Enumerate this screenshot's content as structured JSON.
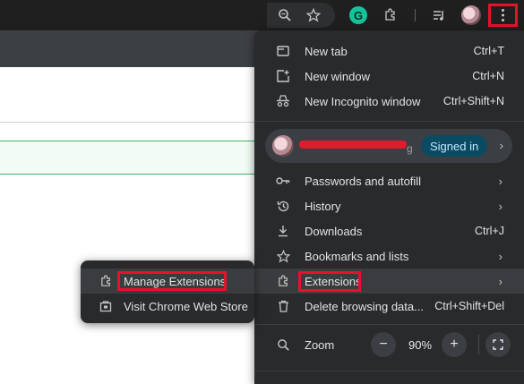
{
  "toolbar": {
    "icons": [
      "zoom-icon",
      "star-icon",
      "grammarly-icon",
      "extensions-puzzle-icon",
      "reading-list-icon",
      "profile-avatar",
      "menu-dots-icon"
    ],
    "grammarly_letter": "G",
    "menu_glyph": "⋮"
  },
  "menu": {
    "new_tab": {
      "label": "New tab",
      "shortcut": "Ctrl+T"
    },
    "new_window": {
      "label": "New window",
      "shortcut": "Ctrl+N"
    },
    "incognito": {
      "label": "New Incognito window",
      "shortcut": "Ctrl+Shift+N"
    },
    "profile": {
      "signed_in": "Signed in"
    },
    "passwords": {
      "label": "Passwords and autofill"
    },
    "history": {
      "label": "History"
    },
    "downloads": {
      "label": "Downloads",
      "shortcut": "Ctrl+J"
    },
    "bookmarks": {
      "label": "Bookmarks and lists"
    },
    "extensions": {
      "label": "Extensions"
    },
    "clear_data": {
      "label": "Delete browsing data...",
      "shortcut": "Ctrl+Shift+Del"
    },
    "zoom": {
      "label": "Zoom",
      "value": "90%",
      "minus": "−",
      "plus": "+"
    }
  },
  "submenu": {
    "manage": {
      "label": "Manage Extensions"
    },
    "store": {
      "label": "Visit Chrome Web Store"
    }
  },
  "colors": {
    "highlight": "#e8112d",
    "menu_bg": "#282a2c",
    "signed_in_bg": "#0b4b62"
  }
}
